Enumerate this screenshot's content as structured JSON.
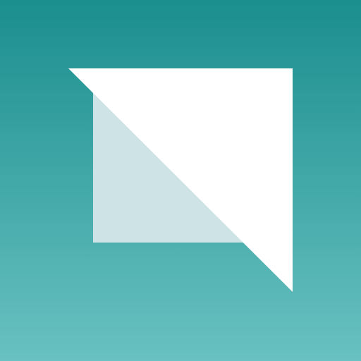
{
  "icon": {
    "name": "app-logo-icon",
    "colors": {
      "background_top": "#1B8E8E",
      "background_bottom": "#69C1C1",
      "square": "#CDE3E6",
      "triangle": "#FFFFFF"
    }
  }
}
